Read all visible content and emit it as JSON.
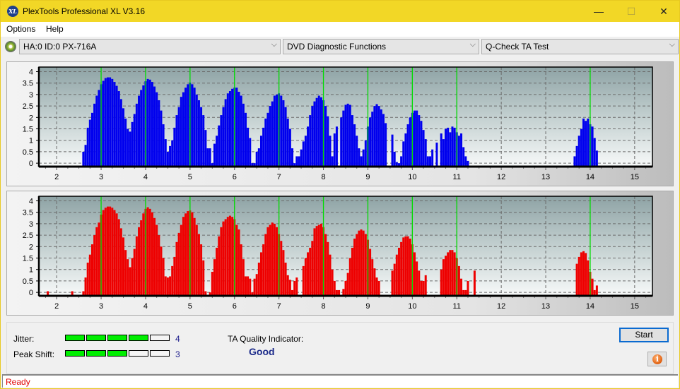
{
  "window": {
    "title": "PlexTools Professional XL V3.16",
    "icon_label": "XL",
    "minimize": "—",
    "maximize": "☐",
    "close": "✕"
  },
  "menu": [
    "Options",
    "Help"
  ],
  "toolbar": {
    "drive": "HA:0 ID:0  PX-716A",
    "function_group": "DVD Diagnostic Functions",
    "test": "Q-Check TA Test",
    "chevron": "⌵"
  },
  "colors": {
    "series_top": "#0000ee",
    "series_bottom": "#ee0000",
    "marker_line": "#00dd00",
    "title_bar": "#f2d726"
  },
  "chart_data": [
    {
      "type": "bar",
      "name": "ta-top",
      "xlim": [
        1.6,
        15.4
      ],
      "ylim": [
        -0.15,
        4.2
      ],
      "x_ticks": [
        "2",
        "3",
        "4",
        "5",
        "6",
        "7",
        "8",
        "9",
        "10",
        "11",
        "12",
        "13",
        "14",
        "15"
      ],
      "y_ticks": [
        "0",
        "0.5",
        "1",
        "1.5",
        "2",
        "2.5",
        "3",
        "3.5",
        "4"
      ],
      "markers": [
        3,
        4,
        5,
        6,
        7,
        8,
        9,
        10,
        11,
        14
      ],
      "grid": true,
      "color": "#0000ee",
      "x": [
        2.6,
        2.65,
        2.7,
        2.75,
        2.8,
        2.85,
        2.9,
        2.95,
        3.0,
        3.05,
        3.1,
        3.15,
        3.2,
        3.25,
        3.3,
        3.35,
        3.4,
        3.45,
        3.5,
        3.55,
        3.6,
        3.65,
        3.7,
        3.75,
        3.8,
        3.85,
        3.9,
        3.95,
        4.0,
        4.05,
        4.1,
        4.15,
        4.2,
        4.25,
        4.3,
        4.35,
        4.4,
        4.45,
        4.5,
        4.55,
        4.6,
        4.65,
        4.7,
        4.75,
        4.8,
        4.85,
        4.9,
        4.95,
        5.0,
        5.05,
        5.1,
        5.15,
        5.2,
        5.25,
        5.3,
        5.35,
        5.4,
        5.45,
        5.5,
        5.55,
        5.6,
        5.65,
        5.7,
        5.75,
        5.8,
        5.85,
        5.9,
        5.95,
        6.0,
        6.05,
        6.1,
        6.15,
        6.2,
        6.25,
        6.3,
        6.35,
        6.4,
        6.45,
        6.5,
        6.55,
        6.6,
        6.65,
        6.7,
        6.75,
        6.8,
        6.85,
        6.9,
        6.95,
        7.0,
        7.05,
        7.1,
        7.15,
        7.2,
        7.25,
        7.3,
        7.35,
        7.4,
        7.45,
        7.5,
        7.55,
        7.6,
        7.65,
        7.7,
        7.75,
        7.8,
        7.85,
        7.9,
        7.95,
        8.0,
        8.05,
        8.1,
        8.15,
        8.2,
        8.25,
        8.3,
        8.4,
        8.45,
        8.5,
        8.55,
        8.6,
        8.65,
        8.7,
        8.75,
        8.8,
        8.85,
        8.9,
        8.95,
        9.0,
        9.05,
        9.1,
        9.15,
        9.2,
        9.25,
        9.3,
        9.35,
        9.4,
        9.55,
        9.6,
        9.65,
        9.7,
        9.75,
        9.8,
        9.85,
        9.9,
        9.95,
        10.0,
        10.05,
        10.1,
        10.15,
        10.2,
        10.25,
        10.3,
        10.35,
        10.4,
        10.45,
        10.55,
        10.65,
        10.7,
        10.75,
        10.8,
        10.85,
        10.9,
        10.95,
        11.0,
        11.05,
        11.1,
        11.15,
        11.2,
        11.25,
        13.65,
        13.7,
        13.75,
        13.8,
        13.85,
        13.9,
        13.95,
        14.0,
        14.05,
        14.1,
        14.15,
        14.2,
        14.25
      ],
      "values": [
        0.5,
        0.8,
        1.55,
        1.9,
        2.2,
        2.6,
        2.95,
        3.2,
        3.45,
        3.6,
        3.72,
        3.75,
        3.75,
        3.68,
        3.55,
        3.38,
        3.15,
        2.8,
        2.4,
        1.95,
        1.5,
        1.38,
        1.8,
        2.15,
        2.6,
        2.95,
        3.2,
        3.4,
        3.58,
        3.68,
        3.65,
        3.55,
        3.35,
        3.1,
        2.75,
        2.3,
        1.7,
        1.05,
        0.5,
        0.75,
        1.0,
        1.55,
        2.1,
        2.45,
        2.9,
        3.1,
        3.3,
        3.45,
        3.52,
        3.45,
        3.3,
        3.0,
        2.75,
        2.45,
        2.1,
        1.45,
        0.65,
        0.65,
        0.0,
        0.85,
        1.2,
        1.65,
        2.1,
        2.45,
        2.8,
        3.05,
        3.15,
        3.25,
        3.3,
        3.3,
        3.12,
        2.95,
        2.6,
        2.2,
        1.55,
        1.1,
        0.0,
        0.0,
        0.5,
        0.65,
        1.2,
        1.55,
        1.95,
        2.2,
        2.5,
        2.7,
        2.95,
        3.0,
        3.05,
        2.95,
        2.75,
        2.45,
        1.95,
        1.5,
        0.65,
        0.0,
        0.3,
        0.3,
        0.6,
        0.95,
        1.2,
        1.6,
        2.1,
        2.5,
        2.7,
        2.85,
        2.95,
        2.88,
        2.75,
        2.5,
        2.05,
        1.2,
        0.3,
        1.3,
        1.6,
        2.0,
        2.3,
        2.55,
        2.6,
        2.55,
        2.1,
        1.7,
        1.2,
        0.65,
        0.3,
        0.6,
        1.0,
        1.6,
        2.0,
        2.25,
        2.5,
        2.58,
        2.5,
        2.35,
        2.15,
        1.75,
        1.25,
        0.5,
        0.05,
        0.0,
        0.3,
        0.95,
        1.3,
        1.7,
        2.0,
        2.2,
        2.3,
        2.3,
        2.1,
        1.85,
        1.45,
        1.05,
        0.3,
        0.3,
        0.6,
        0.9,
        1.3,
        1.05,
        1.5,
        1.55,
        1.35,
        1.6,
        1.55,
        1.35,
        1.2,
        1.3,
        0.7,
        0.3,
        0.1,
        0.3,
        0.75,
        1.2,
        1.5,
        1.95,
        1.85,
        1.95,
        1.7,
        1.6,
        1.1,
        0.55
      ]
    },
    {
      "type": "bar",
      "name": "ta-bottom",
      "xlim": [
        1.6,
        15.4
      ],
      "ylim": [
        -0.15,
        4.2
      ],
      "x_ticks": [
        "2",
        "3",
        "4",
        "5",
        "6",
        "7",
        "8",
        "9",
        "10",
        "11",
        "12",
        "13",
        "14",
        "15"
      ],
      "y_ticks": [
        "0",
        "0.5",
        "1",
        "1.5",
        "2",
        "2.5",
        "3",
        "3.5",
        "4"
      ],
      "markers": [
        3,
        4,
        5,
        6,
        7,
        8,
        9,
        10,
        11,
        14
      ],
      "grid": true,
      "color": "#ee0000",
      "x": [
        1.8,
        2.35,
        2.6,
        2.65,
        2.7,
        2.75,
        2.8,
        2.85,
        2.9,
        2.95,
        3.0,
        3.05,
        3.1,
        3.15,
        3.2,
        3.25,
        3.3,
        3.35,
        3.4,
        3.45,
        3.5,
        3.55,
        3.6,
        3.65,
        3.7,
        3.75,
        3.8,
        3.85,
        3.9,
        3.95,
        4.0,
        4.05,
        4.1,
        4.15,
        4.2,
        4.25,
        4.3,
        4.35,
        4.4,
        4.45,
        4.5,
        4.55,
        4.6,
        4.65,
        4.7,
        4.75,
        4.8,
        4.85,
        4.9,
        4.95,
        5.0,
        5.05,
        5.1,
        5.15,
        5.2,
        5.25,
        5.3,
        5.35,
        5.45,
        5.5,
        5.55,
        5.6,
        5.65,
        5.7,
        5.75,
        5.8,
        5.85,
        5.9,
        5.95,
        6.0,
        6.05,
        6.1,
        6.15,
        6.2,
        6.25,
        6.3,
        6.35,
        6.4,
        6.45,
        6.5,
        6.55,
        6.6,
        6.65,
        6.7,
        6.75,
        6.8,
        6.85,
        6.9,
        6.95,
        7.0,
        7.05,
        7.1,
        7.15,
        7.2,
        7.25,
        7.3,
        7.35,
        7.4,
        7.55,
        7.6,
        7.65,
        7.7,
        7.75,
        7.8,
        7.85,
        7.9,
        7.95,
        8.0,
        8.05,
        8.1,
        8.15,
        8.2,
        8.25,
        8.3,
        8.35,
        8.45,
        8.5,
        8.55,
        8.6,
        8.65,
        8.7,
        8.75,
        8.8,
        8.85,
        8.9,
        8.95,
        9.0,
        9.05,
        9.1,
        9.15,
        9.2,
        9.25,
        9.55,
        9.6,
        9.65,
        9.7,
        9.75,
        9.8,
        9.85,
        9.9,
        9.95,
        10.0,
        10.05,
        10.1,
        10.15,
        10.2,
        10.25,
        10.3,
        10.65,
        10.7,
        10.75,
        10.8,
        10.85,
        10.9,
        10.95,
        11.0,
        11.05,
        11.1,
        11.15,
        11.2,
        11.25,
        11.4,
        13.7,
        13.75,
        13.8,
        13.85,
        13.9,
        13.95,
        14.0,
        14.05,
        14.1,
        14.15,
        14.2,
        14.25
      ],
      "values": [
        0.05,
        0.05,
        0.05,
        0.65,
        1.3,
        1.65,
        2.1,
        2.5,
        2.85,
        3.05,
        3.4,
        3.6,
        3.7,
        3.75,
        3.75,
        3.7,
        3.6,
        3.45,
        3.2,
        2.8,
        2.4,
        1.85,
        1.45,
        1.1,
        1.5,
        1.9,
        2.45,
        2.85,
        3.15,
        3.45,
        3.65,
        3.72,
        3.65,
        3.5,
        3.25,
        2.95,
        2.5,
        2.0,
        1.5,
        0.7,
        0.65,
        0.7,
        1.15,
        1.55,
        2.2,
        2.6,
        2.95,
        3.3,
        3.45,
        3.55,
        3.58,
        3.5,
        3.25,
        2.95,
        2.55,
        2.1,
        1.4,
        0.05,
        0.0,
        0.9,
        1.45,
        1.95,
        2.45,
        2.85,
        3.1,
        3.2,
        3.3,
        3.35,
        3.3,
        3.2,
        2.95,
        2.75,
        2.1,
        1.45,
        0.7,
        0.7,
        0.6,
        0.0,
        0.6,
        0.8,
        1.3,
        1.75,
        2.1,
        2.55,
        2.85,
        2.95,
        3.05,
        3.0,
        2.85,
        2.55,
        2.25,
        1.85,
        1.3,
        0.75,
        0.55,
        0.1,
        0.5,
        0.65,
        1.15,
        1.5,
        1.75,
        1.95,
        2.25,
        2.8,
        2.9,
        2.95,
        3.0,
        2.85,
        2.55,
        2.2,
        1.65,
        1.0,
        0.5,
        0.1,
        0.1,
        0.15,
        0.5,
        0.85,
        1.5,
        1.95,
        2.35,
        2.55,
        2.7,
        2.75,
        2.7,
        2.55,
        2.3,
        1.9,
        1.45,
        1.05,
        0.65,
        0.5,
        0.95,
        1.25,
        1.65,
        1.95,
        2.2,
        2.4,
        2.45,
        2.45,
        2.35,
        2.1,
        1.75,
        1.35,
        0.95,
        0.5,
        0.5,
        0.75,
        1.0,
        1.45,
        1.6,
        1.75,
        1.85,
        1.85,
        1.75,
        1.5,
        1.15,
        0.6,
        0.1,
        0.1,
        0.5,
        0.95,
        1.25,
        1.55,
        1.75,
        1.8,
        1.72,
        1.4,
        0.9,
        0.6,
        0.1,
        0.3
      ]
    }
  ],
  "results": {
    "jitter_label": "Jitter:",
    "jitter_value": "4",
    "jitter_level": 4,
    "peak_shift_label": "Peak Shift:",
    "peak_shift_value": "3",
    "peak_shift_level": 3,
    "level_max": 5,
    "ta_label": "TA Quality Indicator:",
    "ta_quality": "Good"
  },
  "buttons": {
    "start": "Start",
    "info_icon": "i"
  },
  "status": "Ready"
}
